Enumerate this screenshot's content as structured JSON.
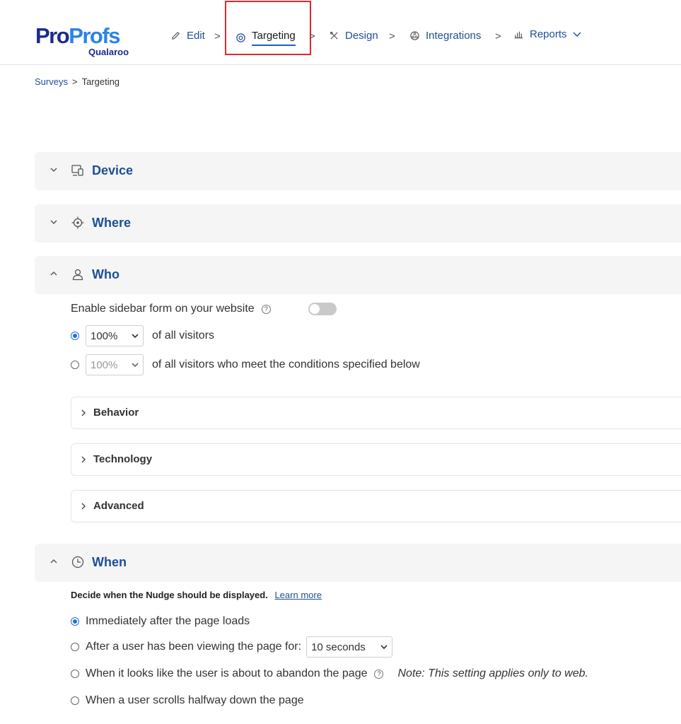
{
  "header": {
    "logo": {
      "pro": "Pro",
      "profs": "Profs",
      "sub": "Qualaroo"
    },
    "nav": [
      {
        "label": "Edit",
        "icon": "pencil-icon"
      },
      {
        "label": "Targeting",
        "icon": "target-icon",
        "active": true
      },
      {
        "label": "Design",
        "icon": "design-tools-icon"
      },
      {
        "label": "Integrations",
        "icon": "integrations-icon"
      },
      {
        "label": "Reports",
        "icon": "bar-chart-icon"
      }
    ],
    "separator": ">",
    "accent": "#1d4f97",
    "highlight_color": "#e0282d"
  },
  "breadcrumb": {
    "items": [
      "Surveys",
      "Targeting"
    ],
    "separator": ">"
  },
  "sections": {
    "device": {
      "title": "Device",
      "icon": "device-icon",
      "expanded": false
    },
    "where": {
      "title": "Where",
      "icon": "crosshair-icon",
      "expanded": false
    },
    "who": {
      "title": "Who",
      "icon": "user-icon",
      "expanded": true
    },
    "when": {
      "title": "When",
      "icon": "clock-icon",
      "expanded": true
    }
  },
  "who": {
    "sidebar_label": "Enable sidebar form on your website",
    "help": "?",
    "sidebar_enabled": false,
    "option1": {
      "value": "100%",
      "text": "of all visitors",
      "selected": true
    },
    "option2": {
      "value": "100%",
      "text": "of all visitors who meet the conditions specified below",
      "selected": false
    },
    "panels": [
      "Behavior",
      "Technology",
      "Advanced"
    ]
  },
  "when": {
    "description": "Decide when the Nudge should be displayed.",
    "learn_more": "Learn more",
    "options": [
      {
        "text": "Immediately after the page loads",
        "selected": true
      },
      {
        "text": "After a user has been viewing the page for:",
        "selected": false,
        "select_value": "10 seconds"
      },
      {
        "text": "When it looks like the user is about to abandon the page",
        "selected": false,
        "note": "Note: This setting applies only to web."
      },
      {
        "text": "When a user scrolls halfway down the page",
        "selected": false
      }
    ]
  }
}
